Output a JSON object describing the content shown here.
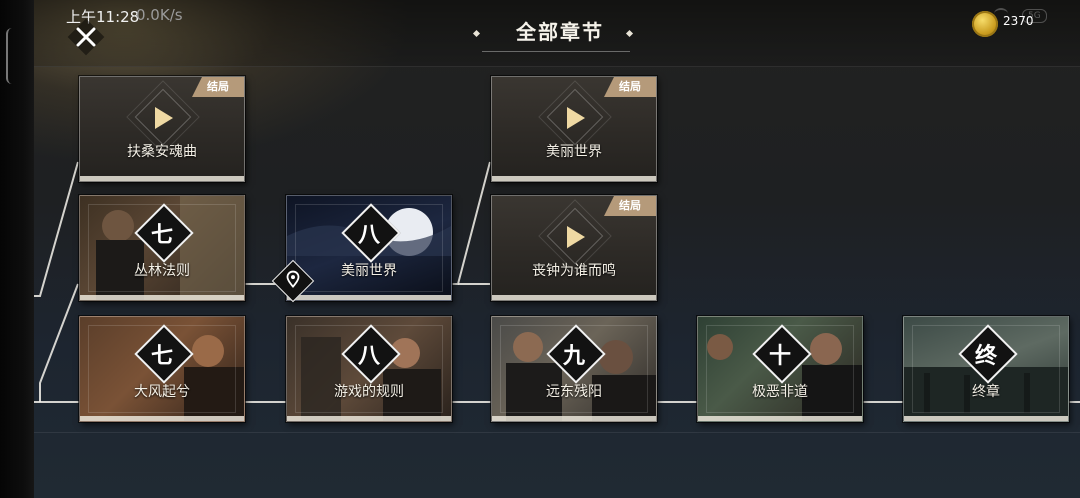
{
  "status": {
    "time": "上午11:28",
    "speed": "0.0K/s",
    "faint_text": "5G"
  },
  "header": {
    "title": "全部章节"
  },
  "currency": {
    "amount": "2370",
    "icon": "gold-coin-icon"
  },
  "colors": {
    "tag_bg": "#b59a7a",
    "accent_gold": "#efd9a3",
    "text": "#f3efe5"
  },
  "nodes": [
    {
      "id": "fusang",
      "label": "扶桑安魂曲",
      "tag": "结局",
      "kind": "ending"
    },
    {
      "id": "meili-1",
      "label": "美丽世界",
      "tag": "结局",
      "kind": "ending"
    },
    {
      "id": "sangzhong",
      "label": "丧钟为谁而鸣",
      "tag": "结局",
      "kind": "ending"
    },
    {
      "id": "conglin",
      "label": "丛林法则",
      "num": "七",
      "kind": "chapter"
    },
    {
      "id": "meili-2",
      "label": "美丽世界",
      "num": "八",
      "kind": "chapter"
    },
    {
      "id": "dafeng",
      "label": "大风起兮",
      "num": "七",
      "kind": "chapter"
    },
    {
      "id": "youxi",
      "label": "游戏的规则",
      "num": "八",
      "kind": "chapter"
    },
    {
      "id": "yuandong",
      "label": "远东残阳",
      "num": "九",
      "kind": "chapter"
    },
    {
      "id": "jie",
      "label": "极恶非道",
      "num": "十",
      "kind": "chapter"
    },
    {
      "id": "zhong",
      "label": "终章",
      "num": "终",
      "kind": "chapter"
    }
  ]
}
